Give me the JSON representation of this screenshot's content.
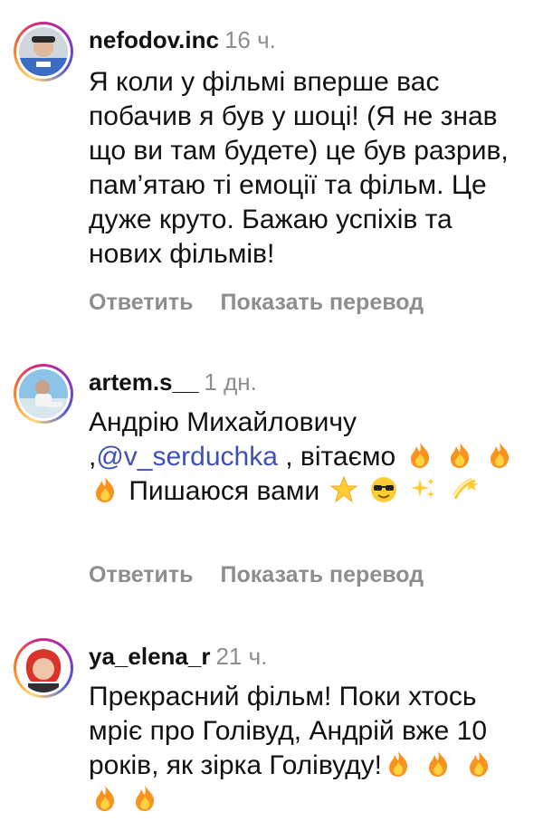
{
  "comments": [
    {
      "username": "nefodov.inc",
      "time": "16 ч.",
      "text": "Я коли у фільмі вперше вас побачив я був у шоці! (Я не знав що ви там будете) це був разрив, пам’ятаю ті емоції та фільм. Це дуже круто. Бажаю успіхів та нових фільмів!",
      "reply_label": "Ответить",
      "translate_label": "Показать перевод"
    },
    {
      "username": "artem.s__",
      "time": "1 дн.",
      "text_part1": "Андрію Михайловичу ,",
      "mention": "@v_serduchka",
      "text_part2": " , вітаємо",
      "text_part3": " Пишаюся вами",
      "reply_label": "Ответить",
      "translate_label": "Показать перевод"
    },
    {
      "username": "ya_elena_r",
      "time": "21 ч.",
      "text": "Прекрасний фільм! Поки хтось мріє про Голівуд, Андрій вже 10 років, як зірка Голівуду!"
    }
  ],
  "icons": {
    "fire": "fire-emoji",
    "star": "glowing-star-emoji",
    "sunglasses": "smiling-face-with-sunglasses-emoji",
    "sparkles": "sparkles-emoji",
    "dizzy": "dizzy-emoji"
  },
  "colors": {
    "username": "#111111",
    "meta": "#8e8e8e",
    "mention": "#3f51b5"
  }
}
